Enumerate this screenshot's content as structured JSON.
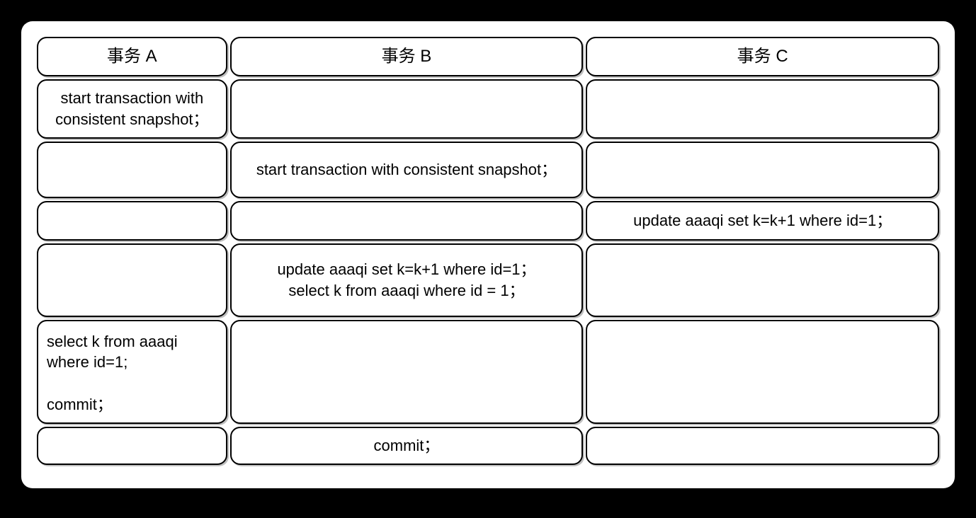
{
  "headers": {
    "a": "事务 A",
    "b": "事务 B",
    "c": "事务 C"
  },
  "rows": [
    {
      "a": "start transaction with\nconsistent snapshot；",
      "b": "",
      "c": ""
    },
    {
      "a": "",
      "b": "start transaction with consistent snapshot；",
      "c": ""
    },
    {
      "a": "",
      "b": "",
      "c": "update aaaqi set k=k+1 where id=1；"
    },
    {
      "a": "",
      "b": "update aaaqi set k=k+1 where id=1；\nselect k from aaaqi where id = 1；",
      "c": ""
    },
    {
      "a": "select k from aaaqi\nwhere id=1;\n\ncommit；",
      "b": "",
      "c": ""
    },
    {
      "a": "",
      "b": "commit；",
      "c": ""
    }
  ]
}
